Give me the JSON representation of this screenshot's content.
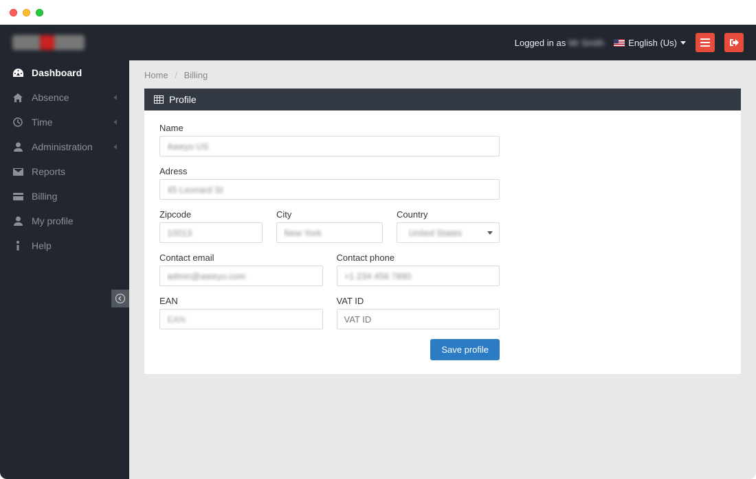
{
  "header": {
    "logged_in_prefix": "Logged in as",
    "user_name": "Mr Smith",
    "language_label": "English (Us)"
  },
  "sidebar": {
    "items": [
      {
        "icon": "tachometer",
        "label": "Dashboard",
        "active": true
      },
      {
        "icon": "home",
        "label": "Absence",
        "expandable": true
      },
      {
        "icon": "clock",
        "label": "Time",
        "expandable": true
      },
      {
        "icon": "user",
        "label": "Administration",
        "expandable": true
      },
      {
        "icon": "envelope",
        "label": "Reports"
      },
      {
        "icon": "credit-card",
        "label": "Billing"
      },
      {
        "icon": "user",
        "label": "My profile"
      },
      {
        "icon": "info",
        "label": "Help"
      }
    ]
  },
  "breadcrumb": {
    "home": "Home",
    "current": "Billing"
  },
  "panel": {
    "title": "Profile"
  },
  "form": {
    "name": {
      "label": "Name",
      "value": "Aweyo US"
    },
    "address": {
      "label": "Adress",
      "value": "45 Leonard St"
    },
    "zipcode": {
      "label": "Zipcode",
      "value": "10013"
    },
    "city": {
      "label": "City",
      "value": "New York"
    },
    "country": {
      "label": "Country",
      "value": "United States"
    },
    "email": {
      "label": "Contact email",
      "value": "admin@aweyo.com"
    },
    "phone": {
      "label": "Contact phone",
      "value": "+1 234 456 7890"
    },
    "ean": {
      "label": "EAN",
      "value": "EAN"
    },
    "vat": {
      "label": "VAT ID",
      "placeholder": "VAT ID",
      "value": ""
    },
    "save_label": "Save profile"
  }
}
